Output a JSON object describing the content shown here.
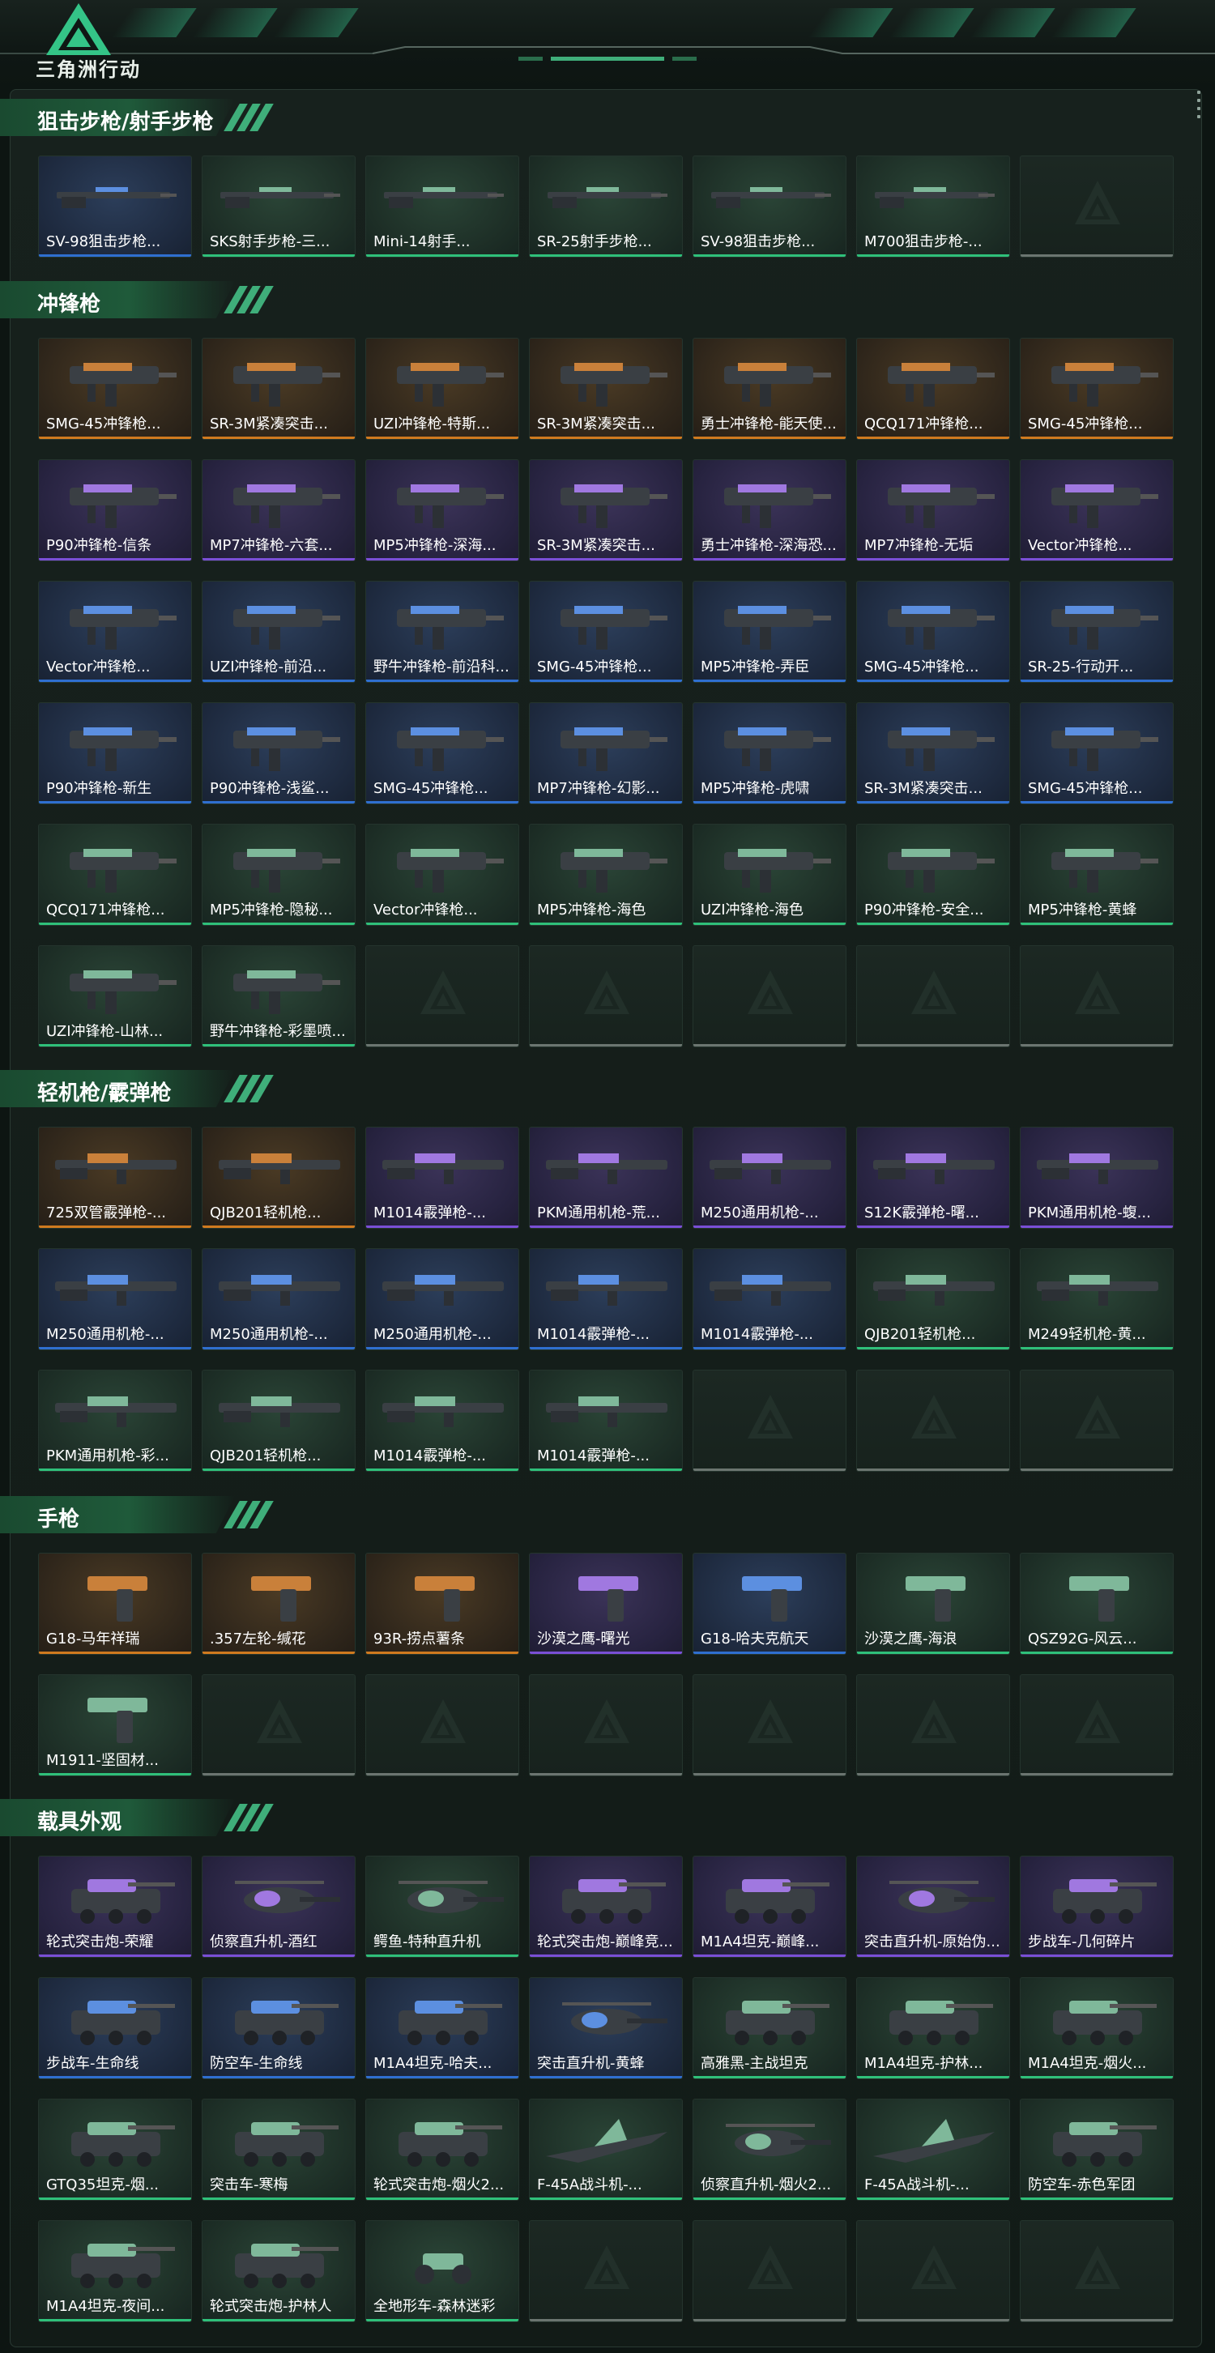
{
  "app": {
    "title": "三角洲行动"
  },
  "colors": {
    "gold": "#d07a1f",
    "purple": "#7a4fd6",
    "blue": "#2f6fd0",
    "green": "#2fc07a",
    "empty": "#6b7570"
  },
  "sections": [
    {
      "title": "狙击步枪/射手步枪",
      "items": [
        {
          "label": "SV-98狙击步枪...",
          "rarity": "blue",
          "icon": "rifle-icon"
        },
        {
          "label": "SKS射手步枪-三...",
          "rarity": "green",
          "icon": "rifle-icon"
        },
        {
          "label": "Mini-14射手...",
          "rarity": "green",
          "icon": "rifle-icon"
        },
        {
          "label": "SR-25射手步枪...",
          "rarity": "green",
          "icon": "rifle-icon"
        },
        {
          "label": "SV-98狙击步枪...",
          "rarity": "green",
          "icon": "rifle-icon"
        },
        {
          "label": "M700狙击步枪-...",
          "rarity": "green",
          "icon": "rifle-icon"
        },
        {
          "label": "",
          "rarity": "empty",
          "icon": "empty-slot-icon"
        }
      ]
    },
    {
      "title": "冲锋枪",
      "items": [
        {
          "label": "SMG-45冲锋枪...",
          "rarity": "gold",
          "icon": "smg-icon"
        },
        {
          "label": "SR-3M紧凑突击...",
          "rarity": "gold",
          "icon": "smg-icon"
        },
        {
          "label": "UZI冲锋枪-特斯...",
          "rarity": "gold",
          "icon": "smg-icon"
        },
        {
          "label": "SR-3M紧凑突击...",
          "rarity": "gold",
          "icon": "smg-icon"
        },
        {
          "label": "勇士冲锋枪-能天使...",
          "rarity": "gold",
          "icon": "smg-icon"
        },
        {
          "label": "QCQ171冲锋枪...",
          "rarity": "gold",
          "icon": "smg-icon"
        },
        {
          "label": "SMG-45冲锋枪...",
          "rarity": "gold",
          "icon": "smg-icon"
        },
        {
          "label": "P90冲锋枪-信条",
          "rarity": "purple",
          "icon": "smg-icon"
        },
        {
          "label": "MP7冲锋枪-六套...",
          "rarity": "purple",
          "icon": "smg-icon"
        },
        {
          "label": "MP5冲锋枪-深海...",
          "rarity": "purple",
          "icon": "smg-icon"
        },
        {
          "label": "SR-3M紧凑突击...",
          "rarity": "purple",
          "icon": "smg-icon"
        },
        {
          "label": "勇士冲锋枪-深海恐...",
          "rarity": "purple",
          "icon": "smg-icon"
        },
        {
          "label": "MP7冲锋枪-无垢",
          "rarity": "purple",
          "icon": "smg-icon"
        },
        {
          "label": "Vector冲锋枪...",
          "rarity": "purple",
          "icon": "smg-icon"
        },
        {
          "label": "Vector冲锋枪...",
          "rarity": "blue",
          "icon": "smg-icon"
        },
        {
          "label": "UZI冲锋枪-前沿...",
          "rarity": "blue",
          "icon": "smg-icon"
        },
        {
          "label": "野牛冲锋枪-前沿科...",
          "rarity": "blue",
          "icon": "smg-icon"
        },
        {
          "label": "SMG-45冲锋枪...",
          "rarity": "blue",
          "icon": "smg-icon"
        },
        {
          "label": "MP5冲锋枪-弄臣",
          "rarity": "blue",
          "icon": "smg-icon"
        },
        {
          "label": "SMG-45冲锋枪...",
          "rarity": "blue",
          "icon": "smg-icon"
        },
        {
          "label": "SR-25-行动开...",
          "rarity": "blue",
          "icon": "smg-icon"
        },
        {
          "label": "P90冲锋枪-新生",
          "rarity": "blue",
          "icon": "smg-icon"
        },
        {
          "label": "P90冲锋枪-浅鲨...",
          "rarity": "blue",
          "icon": "smg-icon"
        },
        {
          "label": "SMG-45冲锋枪...",
          "rarity": "blue",
          "icon": "smg-icon"
        },
        {
          "label": "MP7冲锋枪-幻影...",
          "rarity": "blue",
          "icon": "smg-icon"
        },
        {
          "label": "MP5冲锋枪-虎啸",
          "rarity": "blue",
          "icon": "smg-icon"
        },
        {
          "label": "SR-3M紧凑突击...",
          "rarity": "blue",
          "icon": "smg-icon"
        },
        {
          "label": "SMG-45冲锋枪...",
          "rarity": "blue",
          "icon": "smg-icon"
        },
        {
          "label": "QCQ171冲锋枪...",
          "rarity": "green",
          "icon": "smg-icon"
        },
        {
          "label": "MP5冲锋枪-隐秘...",
          "rarity": "green",
          "icon": "smg-icon"
        },
        {
          "label": "Vector冲锋枪...",
          "rarity": "green",
          "icon": "smg-icon"
        },
        {
          "label": "MP5冲锋枪-海色",
          "rarity": "green",
          "icon": "smg-icon"
        },
        {
          "label": "UZI冲锋枪-海色",
          "rarity": "green",
          "icon": "smg-icon"
        },
        {
          "label": "P90冲锋枪-安全...",
          "rarity": "green",
          "icon": "smg-icon"
        },
        {
          "label": "MP5冲锋枪-黄蜂",
          "rarity": "green",
          "icon": "smg-icon"
        },
        {
          "label": "UZI冲锋枪-山林...",
          "rarity": "green",
          "icon": "smg-icon"
        },
        {
          "label": "野牛冲锋枪-彩墨喷...",
          "rarity": "green",
          "icon": "smg-icon"
        },
        {
          "label": "",
          "rarity": "empty",
          "icon": "empty-slot-icon"
        },
        {
          "label": "",
          "rarity": "empty",
          "icon": "empty-slot-icon"
        },
        {
          "label": "",
          "rarity": "empty",
          "icon": "empty-slot-icon"
        },
        {
          "label": "",
          "rarity": "empty",
          "icon": "empty-slot-icon"
        },
        {
          "label": "",
          "rarity": "empty",
          "icon": "empty-slot-icon"
        }
      ]
    },
    {
      "title": "轻机枪/霰弹枪",
      "items": [
        {
          "label": "725双管霰弹枪-...",
          "rarity": "gold",
          "icon": "shotgun-icon"
        },
        {
          "label": "QJB201轻机枪...",
          "rarity": "gold",
          "icon": "lmg-icon"
        },
        {
          "label": "M1014霰弹枪-...",
          "rarity": "purple",
          "icon": "shotgun-icon"
        },
        {
          "label": "PKM通用机枪-荒...",
          "rarity": "purple",
          "icon": "lmg-icon"
        },
        {
          "label": "M250通用机枪-...",
          "rarity": "purple",
          "icon": "lmg-icon"
        },
        {
          "label": "S12K霰弹枪-曙...",
          "rarity": "purple",
          "icon": "shotgun-icon"
        },
        {
          "label": "PKM通用机枪-蝮...",
          "rarity": "purple",
          "icon": "lmg-icon"
        },
        {
          "label": "M250通用机枪-...",
          "rarity": "blue",
          "icon": "lmg-icon"
        },
        {
          "label": "M250通用机枪-...",
          "rarity": "blue",
          "icon": "lmg-icon"
        },
        {
          "label": "M250通用机枪-...",
          "rarity": "blue",
          "icon": "lmg-icon"
        },
        {
          "label": "M1014霰弹枪-...",
          "rarity": "blue",
          "icon": "shotgun-icon"
        },
        {
          "label": "M1014霰弹枪-...",
          "rarity": "blue",
          "icon": "shotgun-icon"
        },
        {
          "label": "QJB201轻机枪...",
          "rarity": "green",
          "icon": "lmg-icon"
        },
        {
          "label": "M249轻机枪-黄...",
          "rarity": "green",
          "icon": "lmg-icon"
        },
        {
          "label": "PKM通用机枪-彩...",
          "rarity": "green",
          "icon": "lmg-icon"
        },
        {
          "label": "QJB201轻机枪...",
          "rarity": "green",
          "icon": "lmg-icon"
        },
        {
          "label": "M1014霰弹枪-...",
          "rarity": "green",
          "icon": "shotgun-icon"
        },
        {
          "label": "M1014霰弹枪-...",
          "rarity": "green",
          "icon": "shotgun-icon"
        },
        {
          "label": "",
          "rarity": "empty",
          "icon": "empty-slot-icon"
        },
        {
          "label": "",
          "rarity": "empty",
          "icon": "empty-slot-icon"
        },
        {
          "label": "",
          "rarity": "empty",
          "icon": "empty-slot-icon"
        }
      ]
    },
    {
      "title": "手枪",
      "items": [
        {
          "label": "G18-马年祥瑞",
          "rarity": "gold",
          "icon": "pistol-icon"
        },
        {
          "label": ".357左轮-缄花",
          "rarity": "gold",
          "icon": "pistol-icon"
        },
        {
          "label": "93R-捞点薯条",
          "rarity": "gold",
          "icon": "pistol-icon"
        },
        {
          "label": "沙漠之鹰-曙光",
          "rarity": "purple",
          "icon": "pistol-icon"
        },
        {
          "label": "G18-哈夫克航天",
          "rarity": "blue",
          "icon": "pistol-icon"
        },
        {
          "label": "沙漠之鹰-海浪",
          "rarity": "green",
          "icon": "pistol-icon"
        },
        {
          "label": "QSZ92G-风云...",
          "rarity": "green",
          "icon": "pistol-icon"
        },
        {
          "label": "M1911-坚固材...",
          "rarity": "green",
          "icon": "pistol-icon"
        },
        {
          "label": "",
          "rarity": "empty",
          "icon": "empty-slot-icon"
        },
        {
          "label": "",
          "rarity": "empty",
          "icon": "empty-slot-icon"
        },
        {
          "label": "",
          "rarity": "empty",
          "icon": "empty-slot-icon"
        },
        {
          "label": "",
          "rarity": "empty",
          "icon": "empty-slot-icon"
        },
        {
          "label": "",
          "rarity": "empty",
          "icon": "empty-slot-icon"
        },
        {
          "label": "",
          "rarity": "empty",
          "icon": "empty-slot-icon"
        }
      ]
    },
    {
      "title": "载具外观",
      "items": [
        {
          "label": "轮式突击炮-荣耀",
          "rarity": "purple",
          "icon": "armored-car-icon"
        },
        {
          "label": "侦察直升机-酒红",
          "rarity": "purple",
          "icon": "helicopter-icon"
        },
        {
          "label": "鳄鱼-特种直升机",
          "rarity": "green",
          "icon": "helicopter-icon"
        },
        {
          "label": "轮式突击炮-巅峰竞...",
          "rarity": "purple",
          "icon": "armored-car-icon"
        },
        {
          "label": "M1A4坦克-巅峰...",
          "rarity": "purple",
          "icon": "tank-icon"
        },
        {
          "label": "突击直升机-原始伪...",
          "rarity": "purple",
          "icon": "helicopter-icon"
        },
        {
          "label": "步战车-几何碎片",
          "rarity": "purple",
          "icon": "ifv-icon"
        },
        {
          "label": "步战车-生命线",
          "rarity": "blue",
          "icon": "ifv-icon"
        },
        {
          "label": "防空车-生命线",
          "rarity": "blue",
          "icon": "ifv-icon"
        },
        {
          "label": "M1A4坦克-哈夫...",
          "rarity": "blue",
          "icon": "tank-icon"
        },
        {
          "label": "突击直升机-黄蜂",
          "rarity": "blue",
          "icon": "helicopter-icon"
        },
        {
          "label": "高雅黑-主战坦克",
          "rarity": "green",
          "icon": "tank-icon"
        },
        {
          "label": "M1A4坦克-护林...",
          "rarity": "green",
          "icon": "tank-icon"
        },
        {
          "label": "M1A4坦克-烟火...",
          "rarity": "green",
          "icon": "tank-icon"
        },
        {
          "label": "GTQ35坦克-烟...",
          "rarity": "green",
          "icon": "tank-icon"
        },
        {
          "label": "突击车-寒梅",
          "rarity": "green",
          "icon": "armored-car-icon"
        },
        {
          "label": "轮式突击炮-烟火2...",
          "rarity": "green",
          "icon": "armored-car-icon"
        },
        {
          "label": "F-45A战斗机-...",
          "rarity": "green",
          "icon": "jet-icon"
        },
        {
          "label": "侦察直升机-烟火2...",
          "rarity": "green",
          "icon": "helicopter-icon"
        },
        {
          "label": "F-45A战斗机-...",
          "rarity": "green",
          "icon": "jet-icon"
        },
        {
          "label": "防空车-赤色军团",
          "rarity": "green",
          "icon": "ifv-icon"
        },
        {
          "label": "M1A4坦克-夜间...",
          "rarity": "green",
          "icon": "tank-icon"
        },
        {
          "label": "轮式突击炮-护林人",
          "rarity": "green",
          "icon": "armored-car-icon"
        },
        {
          "label": "全地形车-森林迷彩",
          "rarity": "green",
          "icon": "atv-icon"
        },
        {
          "label": "",
          "rarity": "empty",
          "icon": "empty-slot-icon"
        },
        {
          "label": "",
          "rarity": "empty",
          "icon": "empty-slot-icon"
        },
        {
          "label": "",
          "rarity": "empty",
          "icon": "empty-slot-icon"
        },
        {
          "label": "",
          "rarity": "empty",
          "icon": "empty-slot-icon"
        }
      ]
    }
  ]
}
